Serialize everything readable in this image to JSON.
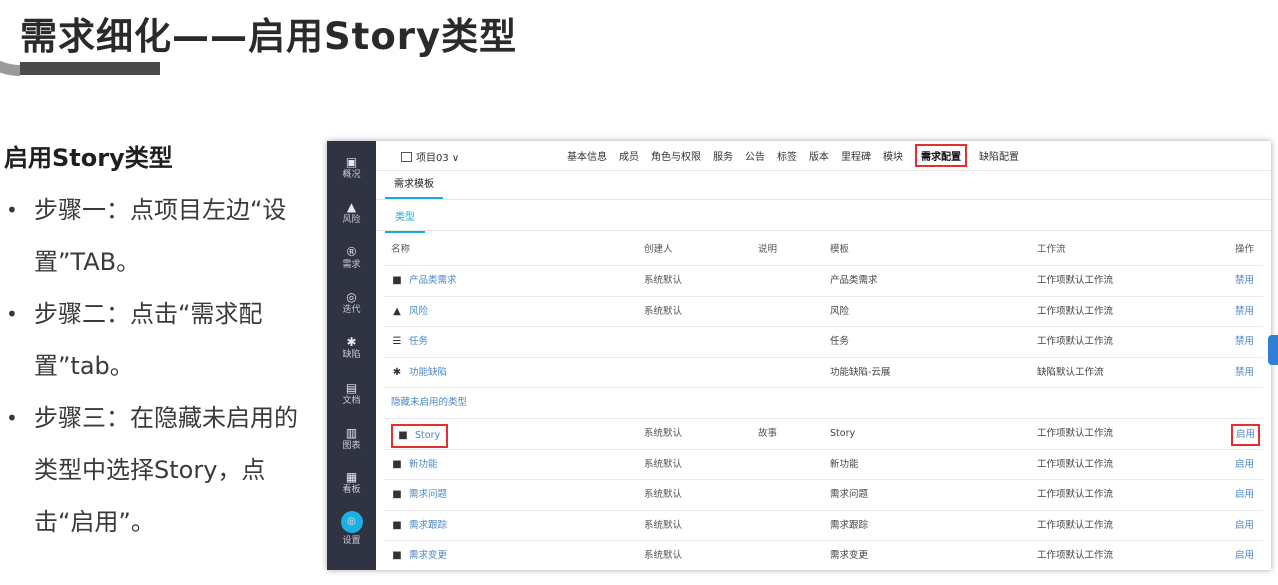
{
  "slide": {
    "title": "需求细化——启用Story类型",
    "heading": "启用Story类型",
    "steps": [
      "步骤一：点项目左边“设置”TAB。",
      "步骤二：点击“需求配置”tab。",
      "步骤三：在隐藏未启用的类型中选择Story，点击“启用”。"
    ],
    "bullet": "•"
  },
  "sidebar": {
    "items": [
      {
        "icon": "overview-icon",
        "glyph": "▣",
        "label": "概况"
      },
      {
        "icon": "warning-icon",
        "glyph": "▲",
        "label": "风险"
      },
      {
        "icon": "requirement-icon",
        "glyph": "®",
        "label": "需求"
      },
      {
        "icon": "iteration-icon",
        "glyph": "◎",
        "label": "迭代"
      },
      {
        "icon": "bug-icon",
        "glyph": "✱",
        "label": "缺陷"
      },
      {
        "icon": "document-icon",
        "glyph": "▤",
        "label": "文档"
      },
      {
        "icon": "chart-icon",
        "glyph": "▥",
        "label": "图表"
      },
      {
        "icon": "board-icon",
        "glyph": "▦",
        "label": "看板"
      },
      {
        "icon": "settings-icon",
        "glyph": "◎",
        "label": "设置"
      }
    ]
  },
  "topbar": {
    "project": "项目03",
    "chevron": "∨",
    "tabs": [
      "基本信息",
      "成员",
      "角色与权限",
      "服务",
      "公告",
      "标签",
      "版本",
      "里程碑",
      "模块",
      "需求配置",
      "缺陷配置"
    ],
    "active_tab": "需求配置"
  },
  "subtabs": {
    "primary": "需求模板",
    "secondary": "类型"
  },
  "table": {
    "headers": {
      "name": "名称",
      "creator": "创建人",
      "desc": "说明",
      "template": "模板",
      "workflow": "工作流",
      "op": "操作"
    },
    "enabled_rows": [
      {
        "icon": "bookmark-icon",
        "glyph": "■",
        "name": "产品类需求",
        "creator": "系统默认",
        "desc": "",
        "template": "产品类需求",
        "workflow": "工作项默认工作流",
        "op": "禁用"
      },
      {
        "icon": "warning-icon",
        "glyph": "▲",
        "name": "风险",
        "creator": "系统默认",
        "desc": "",
        "template": "风险",
        "workflow": "工作项默认工作流",
        "op": "禁用"
      },
      {
        "icon": "task-icon",
        "glyph": "☰",
        "name": "任务",
        "creator": "",
        "desc": "",
        "template": "任务",
        "workflow": "工作项默认工作流",
        "op": "禁用"
      },
      {
        "icon": "bug-icon",
        "glyph": "✱",
        "name": "功能缺陷",
        "creator": "",
        "desc": "",
        "template": "功能缺陷-云展",
        "workflow": "缺陷默认工作流",
        "op": "禁用"
      }
    ],
    "hidden_label": "隐藏未启用的类型",
    "hidden_rows": [
      {
        "icon": "bookmark-icon",
        "glyph": "■",
        "name": "Story",
        "creator": "系统默认",
        "desc": "故事",
        "template": "Story",
        "workflow": "工作项默认工作流",
        "op": "启用"
      },
      {
        "icon": "bookmark-icon",
        "glyph": "■",
        "name": "新功能",
        "creator": "系统默认",
        "desc": "",
        "template": "新功能",
        "workflow": "工作项默认工作流",
        "op": "启用"
      },
      {
        "icon": "bookmark-icon",
        "glyph": "■",
        "name": "需求问题",
        "creator": "系统默认",
        "desc": "",
        "template": "需求问题",
        "workflow": "工作项默认工作流",
        "op": "启用"
      },
      {
        "icon": "bookmark-icon",
        "glyph": "■",
        "name": "需求跟踪",
        "creator": "系统默认",
        "desc": "",
        "template": "需求跟踪",
        "workflow": "工作项默认工作流",
        "op": "启用"
      },
      {
        "icon": "bookmark-icon",
        "glyph": "■",
        "name": "需求变更",
        "creator": "系统默认",
        "desc": "",
        "template": "需求变更",
        "workflow": "工作项默认工作流",
        "op": "启用"
      }
    ]
  },
  "colors": {
    "accent": "#1aa9d6",
    "highlight": "#e0312e",
    "sidebar": "#2f3342",
    "link": "#4a86c8"
  }
}
